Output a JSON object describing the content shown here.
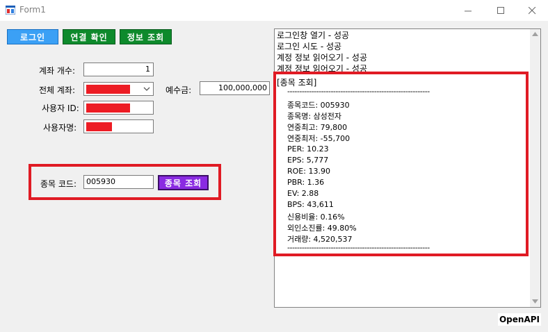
{
  "window": {
    "title": "Form1"
  },
  "buttons": {
    "login": "로그인",
    "connect_check": "연결 확인",
    "info_query": "정보 조회",
    "stock_query": "종목 조회"
  },
  "labels": {
    "account_count": "계좌 개수:",
    "all_accounts": "전체 계좌:",
    "deposit": "예수금:",
    "user_id": "사용자 ID:",
    "user_name": "사용자명:",
    "stock_code": "종목 코드:"
  },
  "fields": {
    "account_count": "1",
    "deposit": "100,000,000",
    "stock_code": "005930"
  },
  "log": {
    "lines": [
      "로그인창 열기 - 성공",
      "로그인 시도 - 성공",
      "계정 정보 읽어오기 - 성공",
      "계정 정보 읽어오기 - 성공"
    ],
    "header": "[종목 조회]",
    "divider": "-----------------------------------------------------------",
    "details": [
      "종목코드: 005930",
      "종목명: 삼성전자",
      "연중최고: 79,800",
      "연중최저: -55,700",
      "PER: 10.23",
      "EPS: 5,777",
      "ROE: 13.90",
      "PBR: 1.36",
      "EV: 2.88",
      "BPS: 43,611",
      "신용비율: 0.16%",
      "외인소진률: 49.80%",
      "거래량: 4,520,537"
    ]
  },
  "footer": {
    "badge": "OpenAPI"
  },
  "colors": {
    "redaction": "#ed1c24",
    "highlight": "#e01b24",
    "login_btn": "#3ba0f5",
    "green_btn": "#0e8a2c",
    "purple_btn": "#8a2be2"
  },
  "icons": [
    "app-icon",
    "minimize-icon",
    "maximize-icon",
    "close-icon",
    "chevron-down-icon",
    "scroll-up-icon",
    "scroll-down-icon"
  ]
}
